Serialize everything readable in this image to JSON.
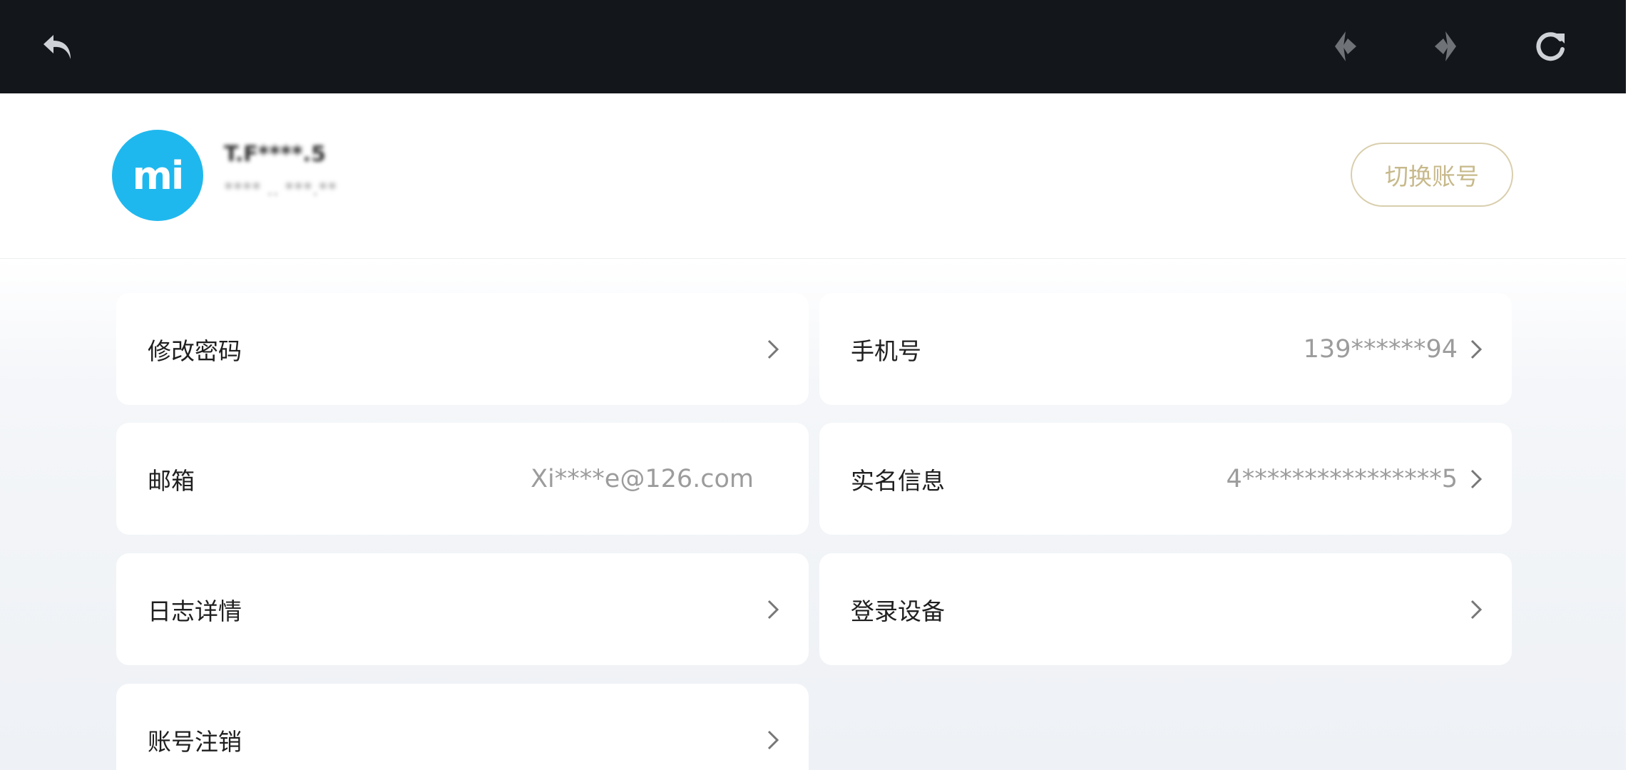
{
  "toolbar": {
    "back_icon": "back-arrow-icon",
    "prev_icon": "prev-diamond-icon",
    "next_icon": "next-diamond-icon",
    "refresh_icon": "refresh-icon"
  },
  "profile": {
    "avatar_text": "mi",
    "name": "T.F****.5",
    "sub": "**** .. ***.**"
  },
  "switch_account_label": "切换账号",
  "items": [
    {
      "label": "修改密码",
      "value": ""
    },
    {
      "label": "手机号",
      "value": "139******94"
    },
    {
      "label": "邮箱",
      "value": "Xi****e@126.com"
    },
    {
      "label": "实名信息",
      "value": "4****************5"
    },
    {
      "label": "日志详情",
      "value": ""
    },
    {
      "label": "登录设备",
      "value": ""
    },
    {
      "label": "账号注销",
      "value": ""
    }
  ],
  "colors": {
    "toolbar_bg": "#13161a",
    "avatar_bg": "#1fb8ee",
    "switch_border": "#d9cfae",
    "switch_text": "#c7b98b"
  }
}
